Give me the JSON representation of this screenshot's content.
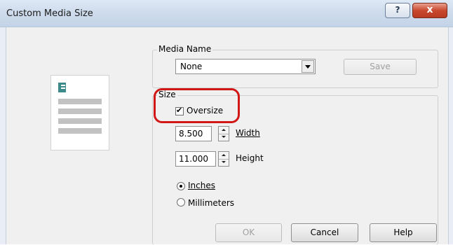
{
  "window": {
    "title": "Custom Media Size",
    "help_glyph": "?",
    "close_glyph": "x"
  },
  "media_name": {
    "legend": "Media Name",
    "selected": "None",
    "save_label": "Save"
  },
  "size": {
    "legend": "Size",
    "oversize": {
      "label": "Oversize",
      "checked": true
    },
    "width": {
      "value": "8.500",
      "label": "Width"
    },
    "height": {
      "value": "11.000",
      "label": "Height"
    },
    "units": [
      {
        "label": "Inches",
        "selected": true
      },
      {
        "label": "Millimeters",
        "selected": false
      }
    ]
  },
  "buttons": {
    "ok": "OK",
    "cancel": "Cancel",
    "help": "Help"
  },
  "colors": {
    "highlight": "#d21717",
    "title_bar": "#cfdcec",
    "close_button": "#c8492f"
  }
}
